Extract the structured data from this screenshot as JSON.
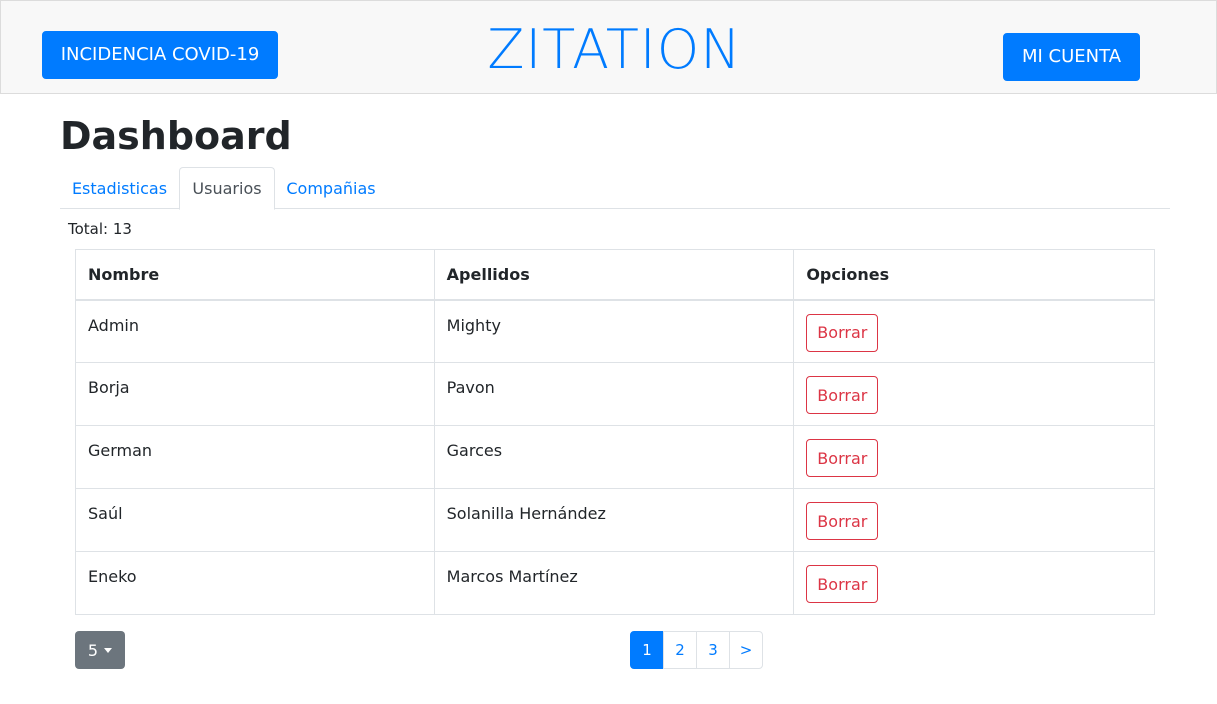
{
  "header": {
    "covid_button": "INCIDENCIA COVID-19",
    "brand": "ZITATION",
    "account_button": "MI CUENTA"
  },
  "page_title": "Dashboard",
  "tabs": [
    {
      "label": "Estadisticas",
      "active": false
    },
    {
      "label": "Usuarios",
      "active": true
    },
    {
      "label": "Compañias",
      "active": false
    }
  ],
  "total_text": "Total: 13",
  "table": {
    "headers": [
      "Nombre",
      "Apellidos",
      "Opciones"
    ],
    "rows": [
      {
        "nombre": "Admin",
        "apellidos": "Mighty",
        "action": "Borrar"
      },
      {
        "nombre": "Borja",
        "apellidos": "Pavon",
        "action": "Borrar"
      },
      {
        "nombre": "German",
        "apellidos": "Garces",
        "action": "Borrar"
      },
      {
        "nombre": "Saúl",
        "apellidos": "Solanilla Hernández",
        "action": "Borrar"
      },
      {
        "nombre": "Eneko",
        "apellidos": "Marcos Martínez",
        "action": "Borrar"
      }
    ]
  },
  "per_page": "5",
  "pagination": {
    "pages": [
      "1",
      "2",
      "3"
    ],
    "active": "1",
    "next": ">"
  },
  "colors": {
    "primary": "#007bff",
    "danger": "#dc3545",
    "secondary": "#6c757d",
    "header_bg": "#f8f8f8"
  }
}
